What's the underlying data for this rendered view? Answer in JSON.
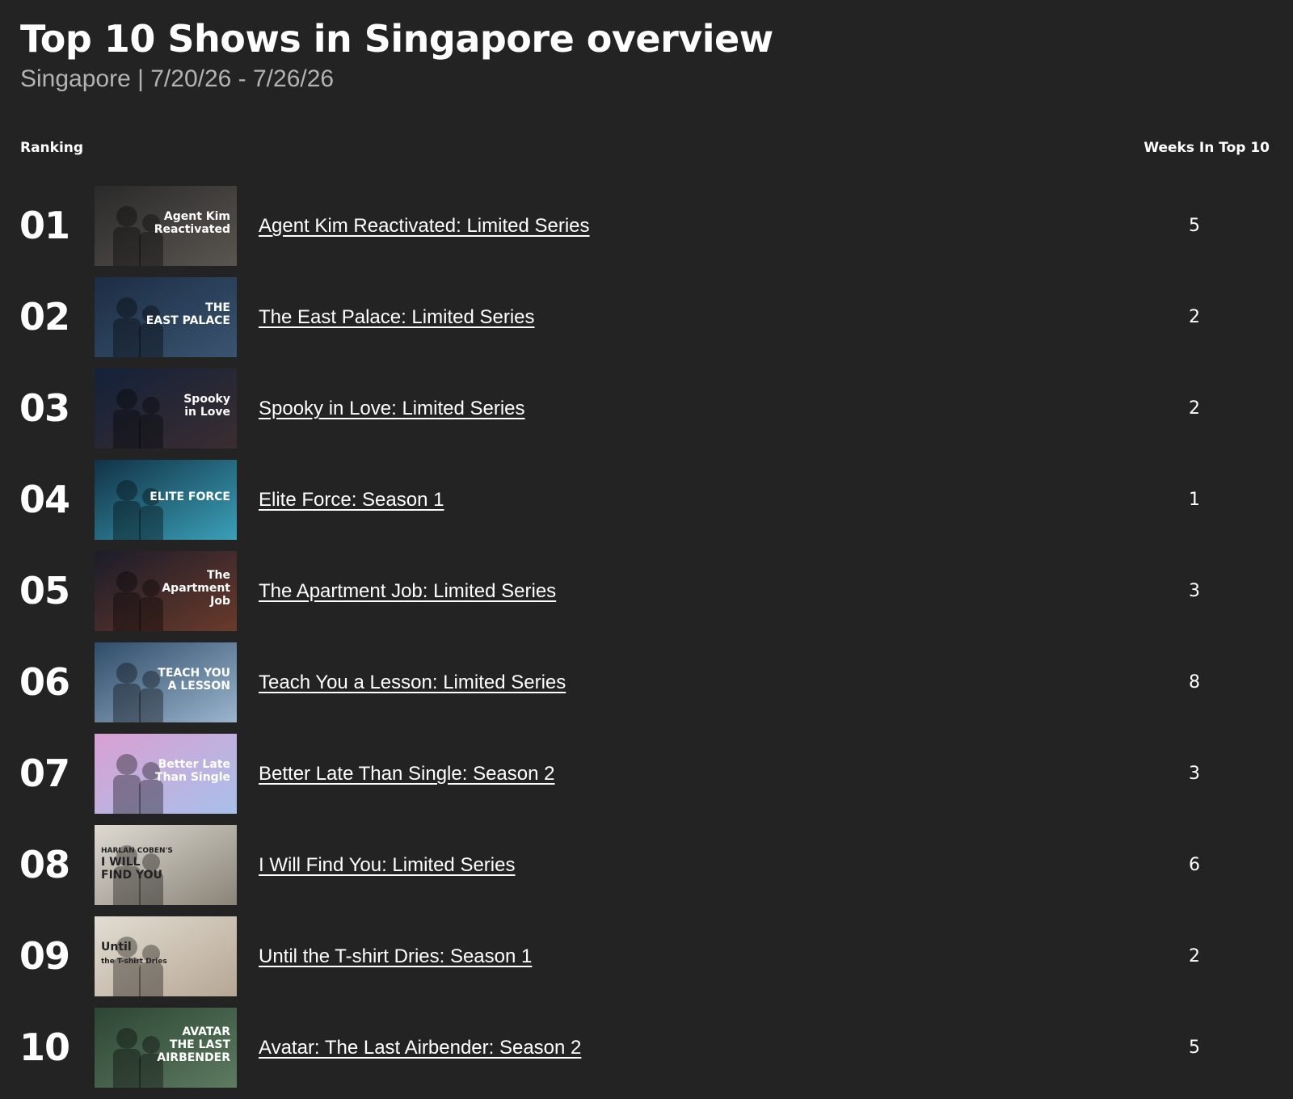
{
  "header": {
    "title": "Top 10 Shows in Singapore overview",
    "subtitle": "Singapore | 7/20/26 - 7/26/26"
  },
  "table": {
    "col_ranking": "Ranking",
    "col_weeks": "Weeks In Top 10",
    "rows": [
      {
        "rank": "01",
        "title": "Agent Kim Reactivated: Limited Series",
        "weeks": "5",
        "thumb_text": [
          "Agent Kim",
          "Reactivated"
        ],
        "thumb_colors": [
          "#2a2a2a",
          "#5a5550"
        ]
      },
      {
        "rank": "02",
        "title": "The East Palace: Limited Series",
        "weeks": "2",
        "thumb_text": [
          "THE",
          "EAST PALACE"
        ],
        "thumb_colors": [
          "#1c2d44",
          "#3a5470"
        ]
      },
      {
        "rank": "03",
        "title": "Spooky in Love: Limited Series",
        "weeks": "2",
        "thumb_text": [
          "Spooky",
          "in Love"
        ],
        "thumb_colors": [
          "#13213a",
          "#3b2d30"
        ]
      },
      {
        "rank": "04",
        "title": "Elite Force: Season 1",
        "weeks": "1",
        "thumb_text": [
          "ELITE FORCE"
        ],
        "thumb_colors": [
          "#123246",
          "#3aa0b8"
        ]
      },
      {
        "rank": "05",
        "title": "The Apartment Job: Limited Series",
        "weeks": "3",
        "thumb_text": [
          "The",
          "Apartment",
          "Job"
        ],
        "thumb_colors": [
          "#1c1c2a",
          "#6a3a2a"
        ]
      },
      {
        "rank": "06",
        "title": "Teach You a Lesson: Limited Series",
        "weeks": "8",
        "thumb_text": [
          "TEACH YOU",
          "A LESSON"
        ],
        "thumb_colors": [
          "#2f4c6a",
          "#9ab5cc"
        ]
      },
      {
        "rank": "07",
        "title": "Better Late Than Single: Season 2",
        "weeks": "3",
        "thumb_text": [
          "Better Late",
          "Than Single"
        ],
        "thumb_colors": [
          "#d9a0d2",
          "#a8c0ea"
        ]
      },
      {
        "rank": "08",
        "title": "I Will Find You: Limited Series",
        "weeks": "6",
        "thumb_text": [
          "HARLAN COBEN'S",
          "I WILL",
          "FIND YOU"
        ],
        "thumb_colors": [
          "#dedad2",
          "#8a8478"
        ]
      },
      {
        "rank": "09",
        "title": "Until the T-shirt Dries: Season 1",
        "weeks": "2",
        "thumb_text": [
          "Until",
          "the T-shirt Dries"
        ],
        "thumb_colors": [
          "#e2ddd2",
          "#b6a694"
        ]
      },
      {
        "rank": "10",
        "title": "Avatar: The Last Airbender: Season 2",
        "weeks": "5",
        "thumb_text": [
          "AVATAR",
          "THE LAST",
          "AIRBENDER"
        ],
        "thumb_colors": [
          "#2c4634",
          "#5e7a60"
        ]
      }
    ]
  }
}
